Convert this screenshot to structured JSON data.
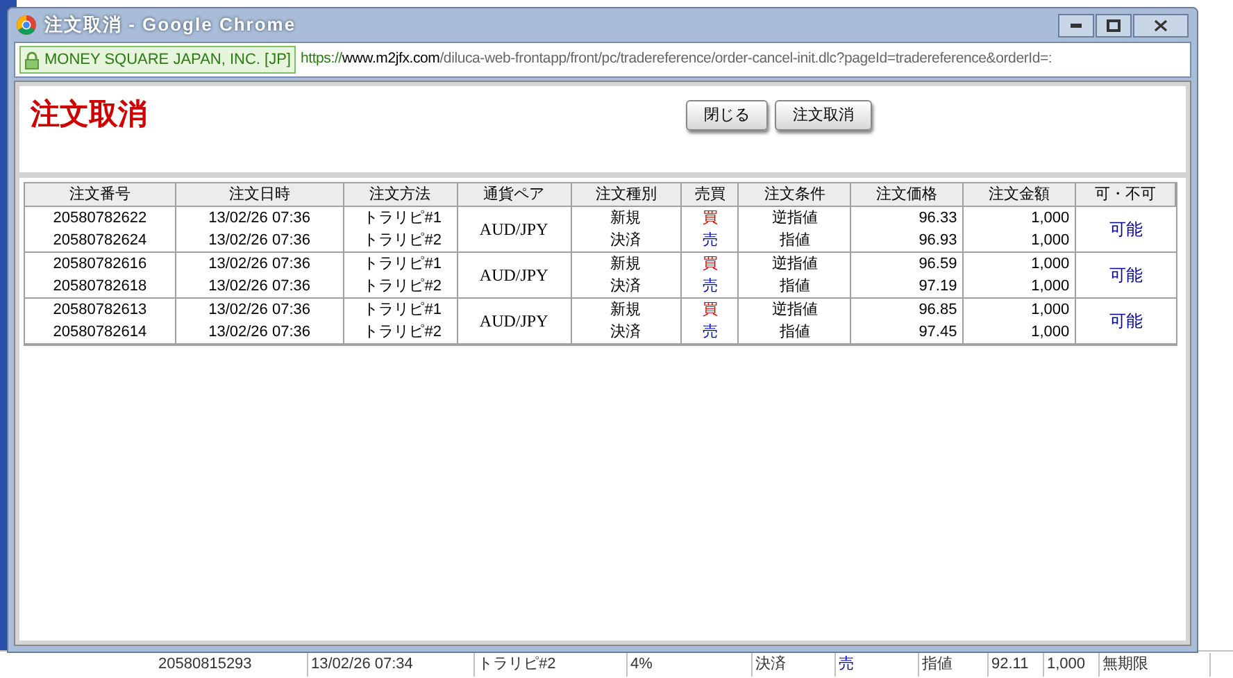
{
  "window": {
    "title": "注文取消 - Google Chrome"
  },
  "address_bar": {
    "identity": "MONEY SQUARE JAPAN, INC. [JP]",
    "url_scheme": "https://",
    "url_host": "www.m2jfx.com",
    "url_path": "/diluca-web-frontapp/front/pc/tradereference/order-cancel-init.dlc?pageId=tradereference&orderId=:"
  },
  "page": {
    "heading": "注文取消",
    "buttons": [
      "閉じる",
      "注文取消"
    ]
  },
  "table": {
    "columns": [
      "注文番号",
      "注文日時",
      "注文方法",
      "通貨ペア",
      "注文種別",
      "売買",
      "注文条件",
      "注文価格",
      "注文金額",
      "可・不可"
    ],
    "groups": [
      {
        "pair": "AUD/JPY",
        "availability": "可能",
        "orders": [
          {
            "number": "20580782622",
            "datetime": "13/02/26 07:36",
            "method": "トラリピ#1",
            "type": "新規",
            "side": "買",
            "color": "#cc0000",
            "condition": "逆指値",
            "price": "96.33",
            "amount": "1,000"
          },
          {
            "number": "20580782624",
            "datetime": "13/02/26 07:36",
            "method": "トラリピ#2",
            "type": "決済",
            "side": "売",
            "color": "#0000cc",
            "condition": "指値",
            "price": "96.93",
            "amount": "1,000"
          }
        ]
      },
      {
        "pair": "AUD/JPY",
        "availability": "可能",
        "orders": [
          {
            "number": "20580782616",
            "datetime": "13/02/26 07:36",
            "method": "トラリピ#1",
            "type": "新規",
            "side": "買",
            "color": "#cc0000",
            "condition": "逆指値",
            "price": "96.59",
            "amount": "1,000"
          },
          {
            "number": "20580782618",
            "datetime": "13/02/26 07:36",
            "method": "トラリピ#2",
            "type": "決済",
            "side": "売",
            "color": "#0000cc",
            "condition": "指値",
            "price": "97.19",
            "amount": "1,000"
          }
        ]
      },
      {
        "pair": "AUD/JPY",
        "availability": "可能",
        "orders": [
          {
            "number": "20580782613",
            "datetime": "13/02/26 07:36",
            "method": "トラリピ#1",
            "type": "新規",
            "side": "買",
            "color": "#cc0000",
            "condition": "逆指値",
            "price": "96.85",
            "amount": "1,000"
          },
          {
            "number": "20580782614",
            "datetime": "13/02/26 07:36",
            "method": "トラリピ#2",
            "type": "決済",
            "side": "売",
            "color": "#0000cc",
            "condition": "指値",
            "price": "97.45",
            "amount": "1,000"
          }
        ]
      }
    ]
  },
  "background_row": {
    "cells": [
      "20580815293",
      "13/02/26 07:34",
      "トラリピ#2",
      "4%",
      "決済",
      "売",
      "指値",
      "92.11",
      "1,000",
      "無期限"
    ]
  }
}
